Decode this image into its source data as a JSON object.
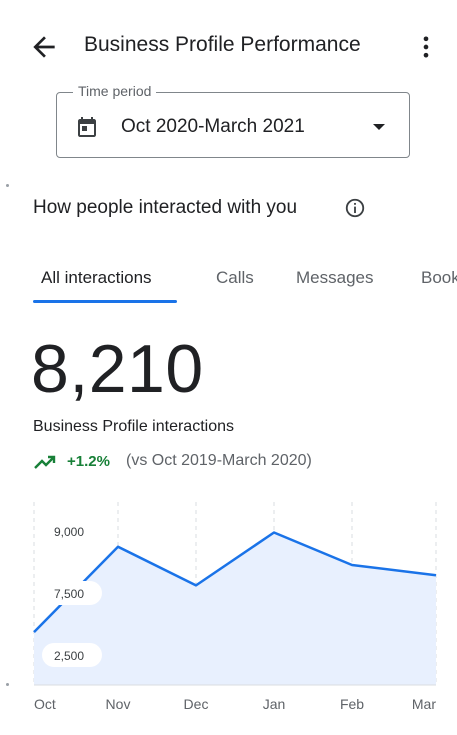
{
  "header": {
    "title": "Business Profile Performance"
  },
  "time_period": {
    "label": "Time period",
    "value": "Oct 2020-March 2021"
  },
  "section": {
    "title": "How people interacted with you"
  },
  "tabs": [
    {
      "label": "All interactions",
      "active": true
    },
    {
      "label": "Calls",
      "active": false
    },
    {
      "label": "Messages",
      "active": false
    },
    {
      "label": "Bookings",
      "active": false
    }
  ],
  "metric": {
    "value": "8,210",
    "label": "Business Profile interactions",
    "change": "+1.2%",
    "comparison": "(vs Oct 2019-March 2020)"
  },
  "colors": {
    "accent": "#1a73e8",
    "positive": "#188038",
    "area_fill": "#e8f0fe"
  },
  "chart_data": {
    "type": "area",
    "categories": [
      "Oct",
      "Nov",
      "Dec",
      "Jan",
      "Feb",
      "Mar"
    ],
    "y_ticks": [
      "9,000",
      "7,500",
      "2,500"
    ],
    "series": [
      {
        "values": [
          6300,
          8400,
          7450,
          8750,
          7950,
          7700
        ]
      }
    ],
    "grid": "vertical-dashed"
  }
}
